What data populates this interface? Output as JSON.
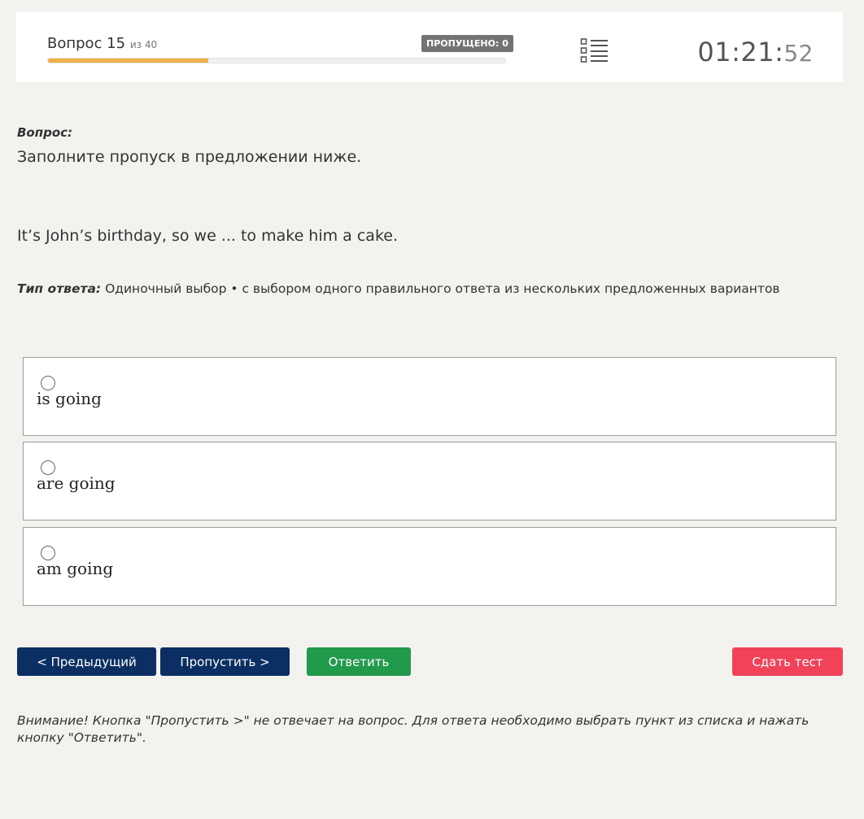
{
  "header": {
    "question_prefix": "Вопрос 15",
    "question_total": "из 40",
    "progress_percent": 35,
    "skipped_badge": "ПРОПУЩЕНО: 0",
    "progress_color": "#f0b048",
    "timer_main": "01:21:",
    "timer_seconds": "52"
  },
  "question": {
    "label": "Вопрос:",
    "instruction": "Заполните пропуск в предложении ниже.",
    "sentence": "It’s John’s birthday, so we ... to make him a cake.",
    "answer_type_label": "Тип ответа:",
    "answer_type_value": " Одиночный выбор • с выбором одного правильного ответа из нескольких предложенных вариантов"
  },
  "options": [
    {
      "text": "is going"
    },
    {
      "text": "are going"
    },
    {
      "text": "am going"
    }
  ],
  "buttons": {
    "prev": "< Предыдущий",
    "skip": "Пропустить >",
    "answer": "Ответить",
    "submit": "Сдать тест"
  },
  "colors": {
    "nav_button": "#0b2e63",
    "answer_button": "#219a4c",
    "submit_button": "#f0435a"
  },
  "note": "Внимание! Кнопка \"Пропустить >\" не отвечает на вопрос. Для ответа необходимо выбрать пункт из списка и нажать кнопку \"Ответить\"."
}
